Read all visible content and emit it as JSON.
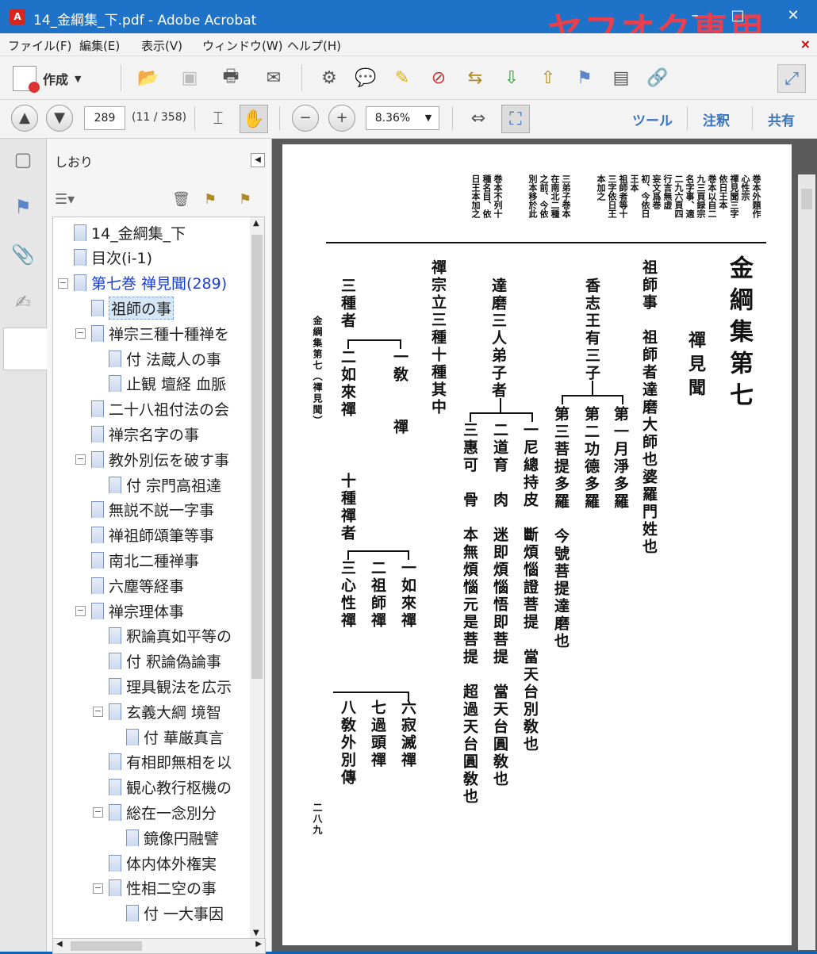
{
  "window": {
    "title": "14_金綱集_下.pdf - Adobe Acrobat",
    "watermark": "ヤフオク専用",
    "app_icon_label": "A"
  },
  "menu": [
    "ファイル(F)",
    "編集(E)",
    "表示(V)",
    "ウィンドウ(W)",
    "ヘルプ(H)"
  ],
  "toolbar": {
    "create_label": "作成",
    "page_number": "289",
    "page_count": "(11 / 358)",
    "zoom": "8.36%",
    "links": [
      "ツール",
      "注釈",
      "共有"
    ]
  },
  "bookmarks_panel": {
    "title": "しおり",
    "items": [
      {
        "label": "14_金綱集_下",
        "depth": 0,
        "toggle": "",
        "color": "#222"
      },
      {
        "label": "目次(i-1)",
        "depth": 0,
        "toggle": "",
        "color": "#222"
      },
      {
        "label": "第七巻 禅見聞(289)",
        "depth": 0,
        "toggle": "−",
        "color": "#1a3fd6"
      },
      {
        "label": "祖師の事",
        "depth": 1,
        "toggle": "",
        "color": "#222",
        "selected": true
      },
      {
        "label": "禅宗三種十種禅を",
        "depth": 1,
        "toggle": "−",
        "color": "#222"
      },
      {
        "label": "付 法蔵人の事",
        "depth": 2,
        "toggle": "",
        "color": "#222"
      },
      {
        "label": "止観 壇経 血脈",
        "depth": 2,
        "toggle": "",
        "color": "#222"
      },
      {
        "label": "二十八祖付法の会",
        "depth": 1,
        "toggle": "",
        "color": "#222"
      },
      {
        "label": "禅宗名字の事",
        "depth": 1,
        "toggle": "",
        "color": "#222"
      },
      {
        "label": "教外別伝を破す事",
        "depth": 1,
        "toggle": "−",
        "color": "#222"
      },
      {
        "label": "付 宗門高祖達",
        "depth": 2,
        "toggle": "",
        "color": "#222"
      },
      {
        "label": "無説不説一字事",
        "depth": 1,
        "toggle": "",
        "color": "#222"
      },
      {
        "label": "禅祖師頌筆等事",
        "depth": 1,
        "toggle": "",
        "color": "#222"
      },
      {
        "label": "南北二種禅事",
        "depth": 1,
        "toggle": "",
        "color": "#222"
      },
      {
        "label": "六塵等経事",
        "depth": 1,
        "toggle": "",
        "color": "#222"
      },
      {
        "label": "禅宗理体事",
        "depth": 1,
        "toggle": "−",
        "color": "#222"
      },
      {
        "label": "釈論真如平等の",
        "depth": 2,
        "toggle": "",
        "color": "#222"
      },
      {
        "label": "付 釈論偽論事",
        "depth": 2,
        "toggle": "",
        "color": "#222"
      },
      {
        "label": "理具観法を広示",
        "depth": 2,
        "toggle": "",
        "color": "#222"
      },
      {
        "label": "玄義大綱 境智",
        "depth": 2,
        "toggle": "−",
        "color": "#222"
      },
      {
        "label": "付 華厳真言",
        "depth": 3,
        "toggle": "",
        "color": "#222"
      },
      {
        "label": "有相即無相を以",
        "depth": 2,
        "toggle": "",
        "color": "#222"
      },
      {
        "label": "観心教行枢機の",
        "depth": 2,
        "toggle": "",
        "color": "#222"
      },
      {
        "label": "総在一念別分",
        "depth": 2,
        "toggle": "−",
        "color": "#222"
      },
      {
        "label": "鏡像円融譬",
        "depth": 3,
        "toggle": "",
        "color": "#222"
      },
      {
        "label": "体内体外権実",
        "depth": 2,
        "toggle": "",
        "color": "#222"
      },
      {
        "label": "性相二空の事",
        "depth": 2,
        "toggle": "−",
        "color": "#222"
      },
      {
        "label": "付 一大事因",
        "depth": 3,
        "toggle": "",
        "color": "#222"
      }
    ]
  },
  "pdf_page": {
    "headnotes": [
      "巻本外題作",
      "心性宗",
      "禪見聞三字",
      "依日王本",
      "巻本以自二",
      "九三頁録宗",
      "名字事、適",
      "二九六頁四",
      "行言無虚",
      "妄文爲巻",
      "初、今依日",
      "王本",
      "祖師者等十",
      "三字依日王",
      "本加之",
      "三弟子巻本",
      "在南北二種",
      "之前、今依",
      "別本移於此",
      "巻本不列十",
      "種名目、依",
      "日王本加之"
    ],
    "title": "金綱集第七",
    "subtitle": "禪見聞",
    "line1": "祖師事　祖師者達磨大師也婆羅門姓也",
    "line2": "香志王有三子",
    "branch1": [
      "第一月淨多羅",
      "第二功德多羅",
      "第三菩提多羅　今號菩提達磨也"
    ],
    "line3": "達磨三人弟子者",
    "branch2": [
      "一尼總持皮　斷煩惱證菩提　當天台別敎也",
      "二道育　肉　迷即煩惱悟即菩提　當天台圓敎也",
      "三惠可　骨　本無煩惱元是菩提　超過天台圓敎也"
    ],
    "line4": "禪宗立三種十種其中",
    "three_label": "三種者",
    "three_items": [
      "一敎　　禪",
      "二如來禪"
    ],
    "ten_label": "十種禪者",
    "ten_items": [
      "一如來禪",
      "二祖師禪",
      "三心性禪",
      "六寂滅禪",
      "七過頭禪",
      "八敎外別傳"
    ],
    "footer_title": "金綱集第七（禪見聞）",
    "page_no": "二八九"
  }
}
